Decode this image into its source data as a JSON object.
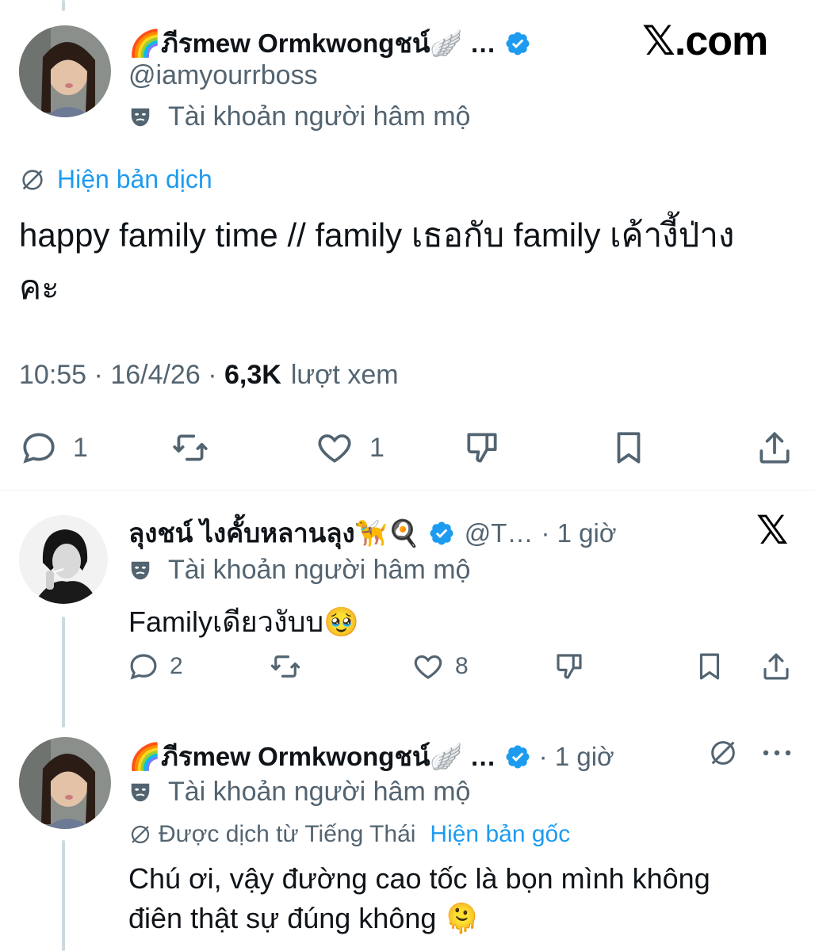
{
  "brand": {
    "watermark": "𝕏.com",
    "reply_logo": "𝕏"
  },
  "main_tweet": {
    "name": "🌈ภีรmew Ormkwongชน์🪽 …",
    "handle": "@iamyourrboss",
    "label": "Tài khoản người hâm mộ",
    "translate_link": "Hiện bản dịch",
    "text_line1": "happy family time // family เธอกับ family เค้างี้ป่าง",
    "text_line2": "คะ",
    "time": "10:55",
    "date": "16/4/26",
    "views_count": "6,3K",
    "views_label": "lượt xem",
    "replies": "1",
    "likes": "1"
  },
  "reply1": {
    "name": "ลุงชน์ ไงคั้บหลานลุง🦮🍳",
    "handle": "@T…",
    "time": "· 1 giờ",
    "label": "Tài khoản người hâm mộ",
    "text": "Familyเดียวงับบ🥹",
    "replies": "2",
    "likes": "8"
  },
  "reply2": {
    "name": "🌈ภีรmew Ormkwongชน์🪽 …",
    "time": "· 1 giờ",
    "label": "Tài khoản người hâm mộ",
    "translated_from": "Được dịch từ Tiếng Thái",
    "show_original": "Hiện bản gốc",
    "text_line1": "Chú ơi, vậy đường cao tốc là bọn mình không",
    "text_line2": "điên thật sự đúng không 🫠"
  },
  "colors": {
    "accent": "#1d9bf0",
    "muted": "#536471",
    "text": "#0f1419"
  }
}
